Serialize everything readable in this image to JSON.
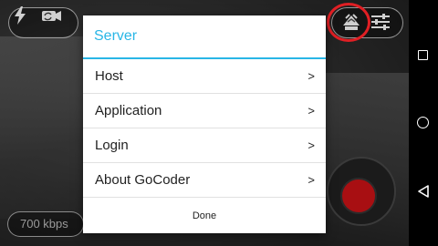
{
  "controls": {
    "bitrate": "700 kbps"
  },
  "dialog": {
    "title": "Server",
    "items": [
      {
        "label": "Host",
        "chevron": ">"
      },
      {
        "label": "Application",
        "chevron": ">"
      },
      {
        "label": "Login",
        "chevron": ">"
      },
      {
        "label": "About GoCoder",
        "chevron": ">"
      }
    ],
    "done_label": "Done"
  },
  "icons": {
    "flash": "flash-icon",
    "camera_switch": "camera-switch-icon",
    "broadcast": "broadcast-icon",
    "settings": "settings-sliders-icon",
    "record": "record-icon",
    "nav_recent": "square-icon",
    "nav_home": "circle-icon",
    "nav_back": "triangle-back-icon"
  },
  "colors": {
    "accent": "#29b6e6",
    "highlight": "#e01f24",
    "record": "#a80f12"
  }
}
